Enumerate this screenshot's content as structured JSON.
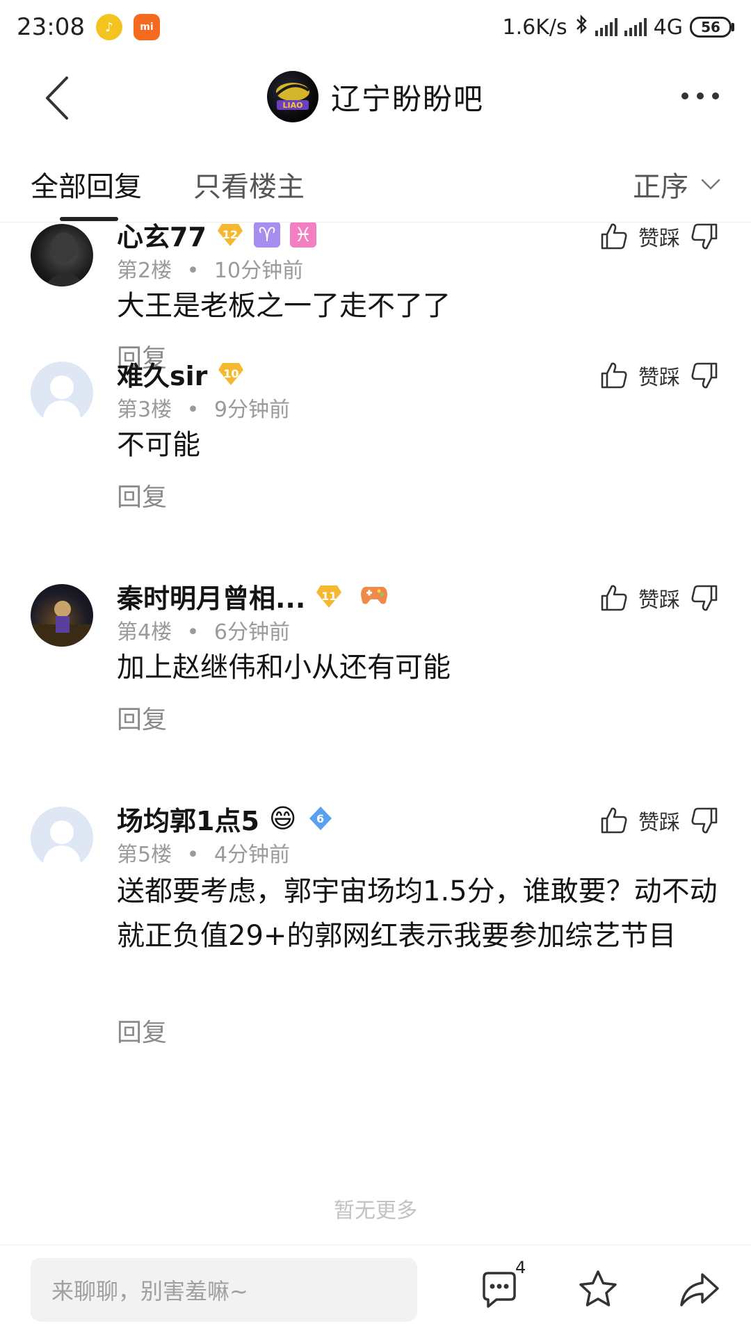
{
  "status_bar": {
    "time": "23:08",
    "network_speed": "1.6K/s",
    "network_type": "4G",
    "battery": "56"
  },
  "nav": {
    "title": "辽宁盼盼吧"
  },
  "tabs": {
    "all_replies": "全部回复",
    "owner_only": "只看楼主",
    "sort": "正序"
  },
  "replies": [
    {
      "username": "心玄77",
      "level": "12",
      "floor": "第2楼",
      "time": "10分钟前",
      "content": "大王是老板之一了走不了了",
      "reply_label": "回复",
      "vote_label": "赞踩"
    },
    {
      "username": "难久sir",
      "level": "10",
      "floor": "第3楼",
      "time": "9分钟前",
      "content": "不可能",
      "reply_label": "回复",
      "vote_label": "赞踩"
    },
    {
      "username": "秦时明月曾相...",
      "level": "11",
      "floor": "第4楼",
      "time": "6分钟前",
      "content": "加上赵继伟和小从还有可能",
      "reply_label": "回复",
      "vote_label": "赞踩"
    },
    {
      "username": "场均郭1点5",
      "level": "6",
      "floor": "第5楼",
      "time": "4分钟前",
      "content": "送都要考虑，郭宇宙场均1.5分，谁敢要？动不动就正负值29+的郭网红表示我要参加综艺节目",
      "reply_label": "回复",
      "vote_label": "赞踩"
    }
  ],
  "separator": "•",
  "end_text": "暂无更多",
  "bottom_bar": {
    "input_placeholder": "来聊聊，别害羞嘛~",
    "comment_count": "4"
  },
  "colors": {
    "level_gold": "#f5b82e",
    "level_blue": "#5aa0f0",
    "text_primary": "#141414",
    "text_meta": "#9a9a9a"
  }
}
